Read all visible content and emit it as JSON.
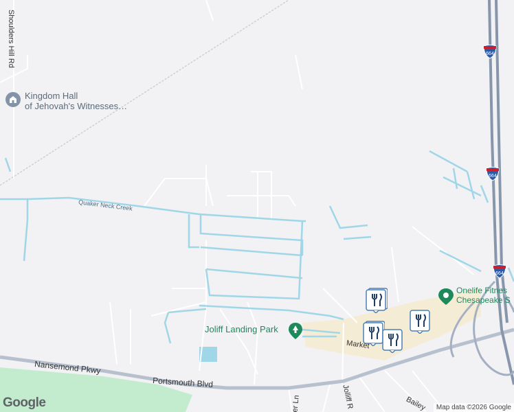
{
  "map": {
    "pois": {
      "kingdom_hall": {
        "line1": "Kingdom Hall",
        "line2": "of Jehovah's Witnesses…",
        "icon": "place-of-worship-icon"
      },
      "joliff_landing_park": {
        "label": "Joliff Landing Park",
        "icon": "park-tree-icon"
      },
      "onelife_fitness": {
        "line1": "Onelife Fitnes",
        "line2": "Chesapeake S",
        "icon": "fitness-marker-icon"
      }
    },
    "roads": {
      "shoulders_hill": "Shoulders Hill Rd",
      "nansemond": "Nansemond Pkwy",
      "portsmouth": "Portsmouth Blvd",
      "market": "Market",
      "joliff_r": "Jolliff R",
      "bailey": "Bailey",
      "er_ln": "er Ln"
    },
    "water": {
      "quaker_neck_creek": "Quaker Neck Creek"
    },
    "interstate_shields": [
      "664",
      "664",
      "664"
    ],
    "restaurant_markers_icon": "restaurant-fork-knife-icon",
    "colors": {
      "water": "#9fd6e8",
      "park": "#c3eccf",
      "highway": "#9aa8bc",
      "commercial": "#f5ecd6"
    }
  },
  "footer": {
    "logo": "Google",
    "attribution": "Map data ©2026 Google"
  }
}
